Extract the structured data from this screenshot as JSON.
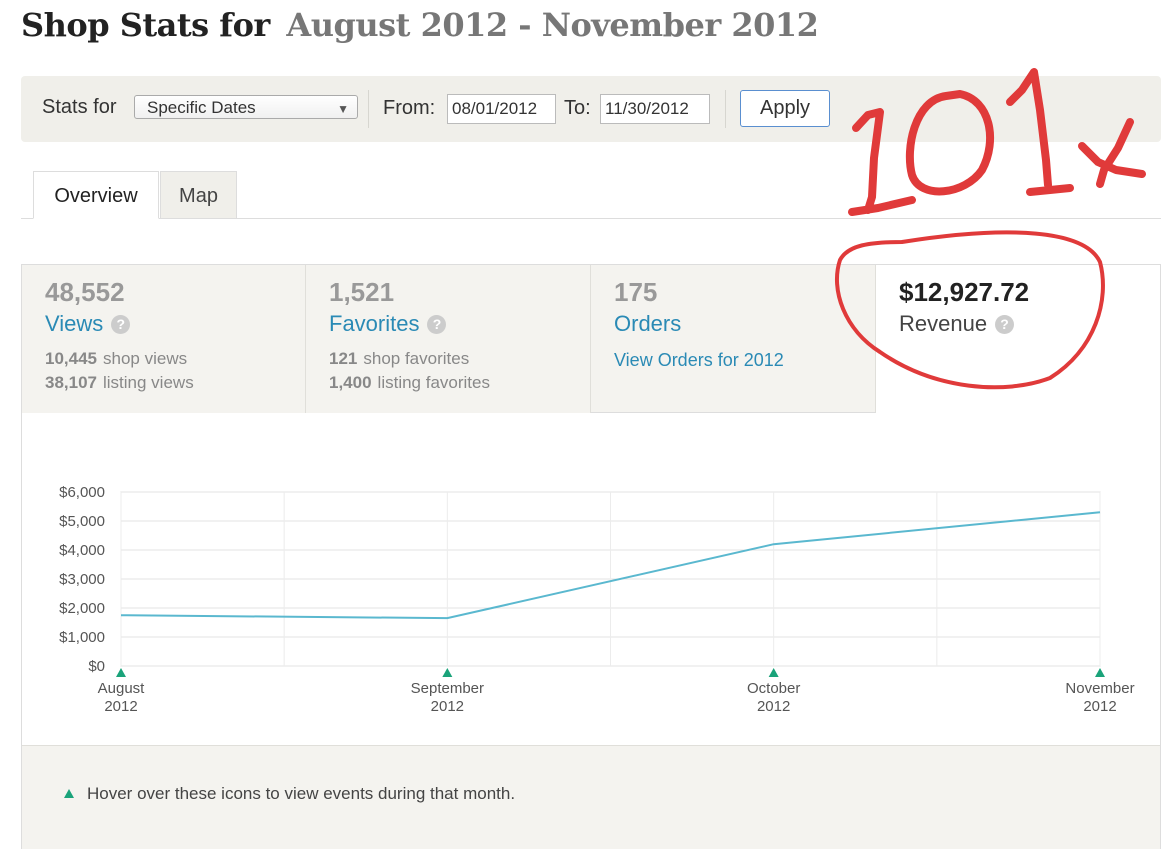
{
  "header": {
    "title": "Shop Stats for",
    "range": "August 2012 - November 2012"
  },
  "filters": {
    "stats_for_label": "Stats for",
    "stats_for_value": "Specific Dates",
    "from_label": "From:",
    "from_value": "08/01/2012",
    "to_label": "To:",
    "to_value": "11/30/2012",
    "apply_label": "Apply"
  },
  "tabs": [
    {
      "label": "Overview",
      "active": true
    },
    {
      "label": "Map",
      "active": false
    }
  ],
  "stats": {
    "views": {
      "value": "48,552",
      "label": "Views",
      "line1_num": "10,445",
      "line1_text": "shop views",
      "line2_num": "38,107",
      "line2_text": "listing views"
    },
    "favorites": {
      "value": "1,521",
      "label": "Favorites",
      "line1_num": "121",
      "line1_text": "shop favorites",
      "line2_num": "1,400",
      "line2_text": "listing favorites"
    },
    "orders": {
      "value": "175",
      "label": "Orders",
      "link": "View Orders for 2012"
    },
    "revenue": {
      "value": "$12,927.72",
      "label": "Revenue"
    }
  },
  "annotation": {
    "text": "101x",
    "color": "#e03a3a"
  },
  "hint": {
    "text": "Hover over these icons to view events during that month."
  },
  "colors": {
    "line": "#5ab8cf",
    "marker": "#1aa37a",
    "link": "#2a8ab5"
  },
  "chart_data": {
    "type": "line",
    "categories": [
      "August 2012",
      "September 2012",
      "October 2012",
      "November 2012"
    ],
    "x_tick_labels": [
      [
        "August",
        "2012"
      ],
      [
        "September",
        "2012"
      ],
      [
        "October",
        "2012"
      ],
      [
        "November",
        "2012"
      ]
    ],
    "series": [
      {
        "values": [
          1750,
          1650,
          4200,
          5300
        ]
      }
    ],
    "y_ticks": [
      "$0",
      "$1,000",
      "$2,000",
      "$3,000",
      "$4,000",
      "$5,000",
      "$6,000"
    ],
    "ylim": [
      0,
      6000
    ],
    "grid": true,
    "title": "",
    "xlabel": "",
    "ylabel": ""
  }
}
